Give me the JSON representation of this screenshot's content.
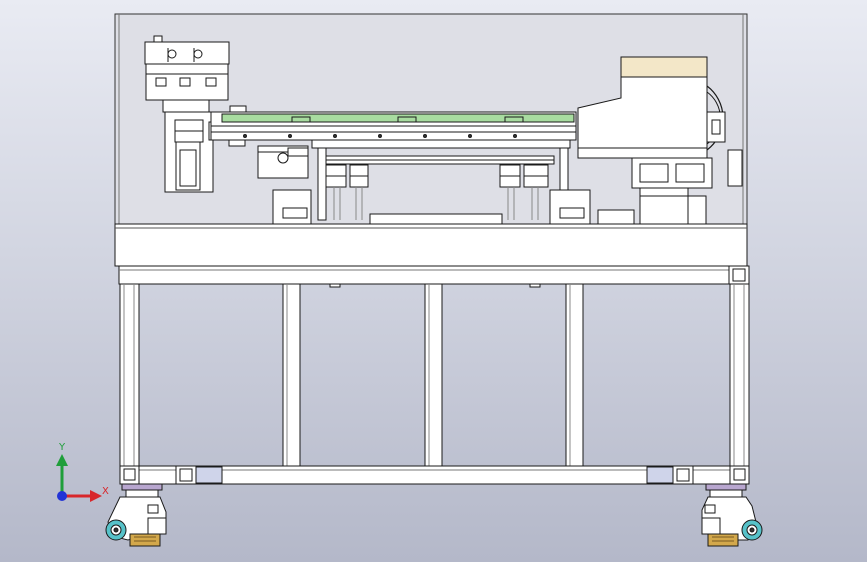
{
  "viewport": {
    "background_top": "#e9ebf3",
    "background_bottom": "#b4b8c9"
  },
  "triad": {
    "x_label": "X",
    "y_label": "Y",
    "x_color": "#d8262a",
    "y_color": "#1f9e3a",
    "z_color": "#2233d6"
  },
  "colors": {
    "line": "#1a1a1a",
    "fill": "#ffffff",
    "conveyor_belt": "#a8dca0",
    "cover": "#f3e7c8",
    "wheel": "#57c2c9",
    "brass": "#d3a84b",
    "foot_pad": "#b8a6cf",
    "guard_tint": "#dedfe6"
  }
}
